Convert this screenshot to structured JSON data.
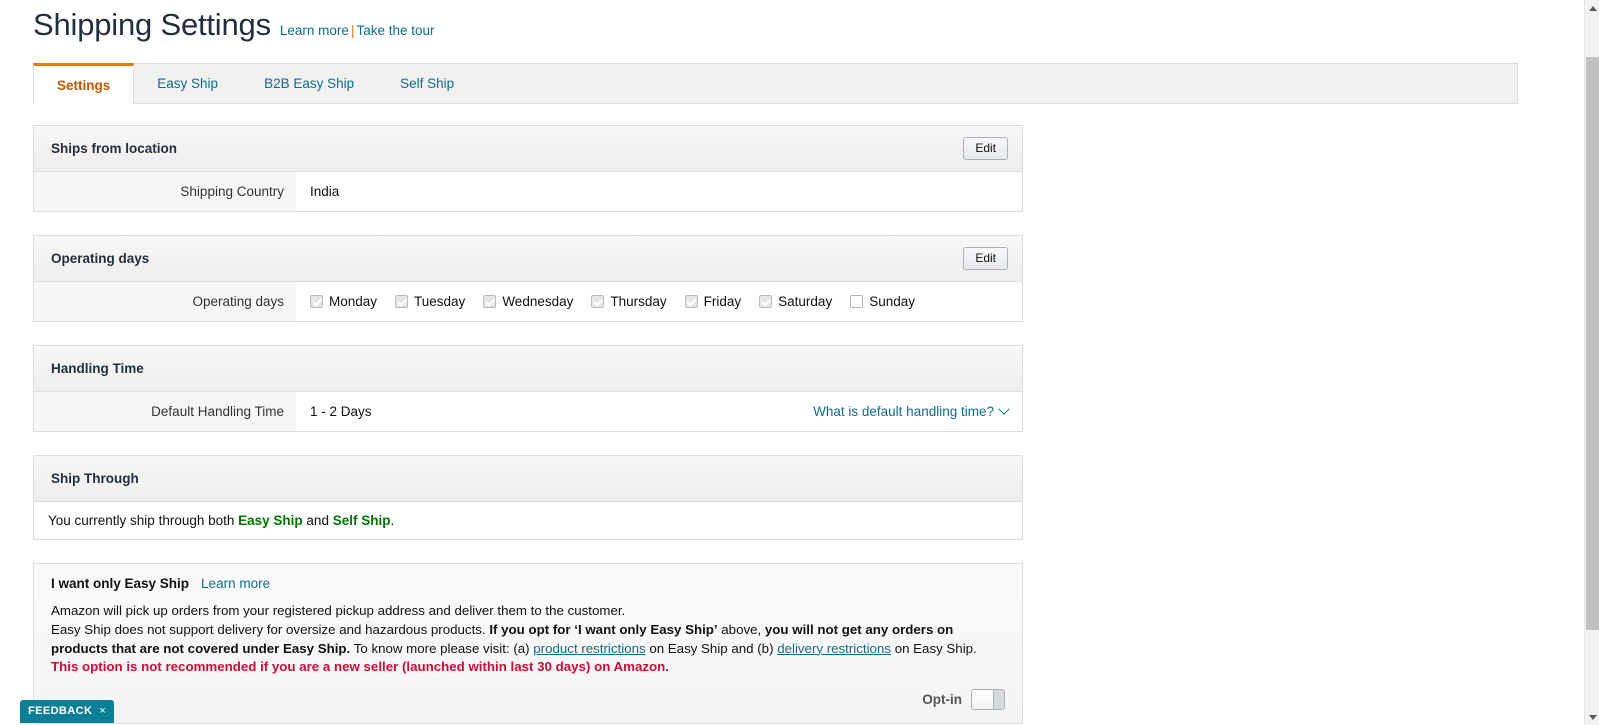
{
  "header": {
    "title": "Shipping Settings",
    "learn_more": "Learn more",
    "separator": "|",
    "take_tour": "Take the tour"
  },
  "tabs": [
    {
      "label": "Settings",
      "active": true
    },
    {
      "label": "Easy Ship",
      "active": false
    },
    {
      "label": "B2B Easy Ship",
      "active": false
    },
    {
      "label": "Self Ship",
      "active": false
    }
  ],
  "panels": {
    "ships_from": {
      "title": "Ships from location",
      "edit_label": "Edit",
      "row_label": "Shipping Country",
      "row_value": "India"
    },
    "operating_days": {
      "title": "Operating days",
      "edit_label": "Edit",
      "row_label": "Operating days",
      "days": [
        {
          "label": "Monday",
          "checked": true
        },
        {
          "label": "Tuesday",
          "checked": true
        },
        {
          "label": "Wednesday",
          "checked": true
        },
        {
          "label": "Thursday",
          "checked": true
        },
        {
          "label": "Friday",
          "checked": true
        },
        {
          "label": "Saturday",
          "checked": true
        },
        {
          "label": "Sunday",
          "checked": false
        }
      ]
    },
    "handling_time": {
      "title": "Handling Time",
      "row_label": "Default Handling Time",
      "row_value": "1 - 2 Days",
      "help_link": "What is default handling time?"
    },
    "ship_through": {
      "title": "Ship Through",
      "body_prefix": "You currently ship through both ",
      "method_a": "Easy Ship",
      "body_middle": " and ",
      "method_b": "Self Ship",
      "body_suffix": "."
    }
  },
  "optin": {
    "title": "I want only Easy Ship",
    "learn_more": "Learn more",
    "line1": "Amazon will pick up orders from your registered pickup address and deliver them to the customer.",
    "line2_a": "Easy Ship does not support delivery for oversize and hazardous products. ",
    "line2_b": "If you opt for ‘I want only Easy Ship’",
    "line2_c": " above, ",
    "line2_d": "you will not get any orders on products that are not covered under Easy Ship.",
    "line3_a": " To know more please visit: (a) ",
    "link_product": "product restrictions",
    "line3_b": " on Easy Ship and (b) ",
    "link_delivery": "delivery restrictions",
    "line3_c": " on Easy Ship.",
    "warning": "This option is not recommended if you are a new seller (launched within last 30 days) on Amazon.",
    "toggle_label": "Opt-in",
    "toggle_on": false
  },
  "feedback": {
    "label": "FEEDBACK",
    "close": "×"
  },
  "colors": {
    "accent_orange": "#e47911",
    "link_teal": "#0f6c8c",
    "green": "#007600",
    "warning_red": "#cc0c39",
    "feedback_teal": "#0b7f95"
  }
}
